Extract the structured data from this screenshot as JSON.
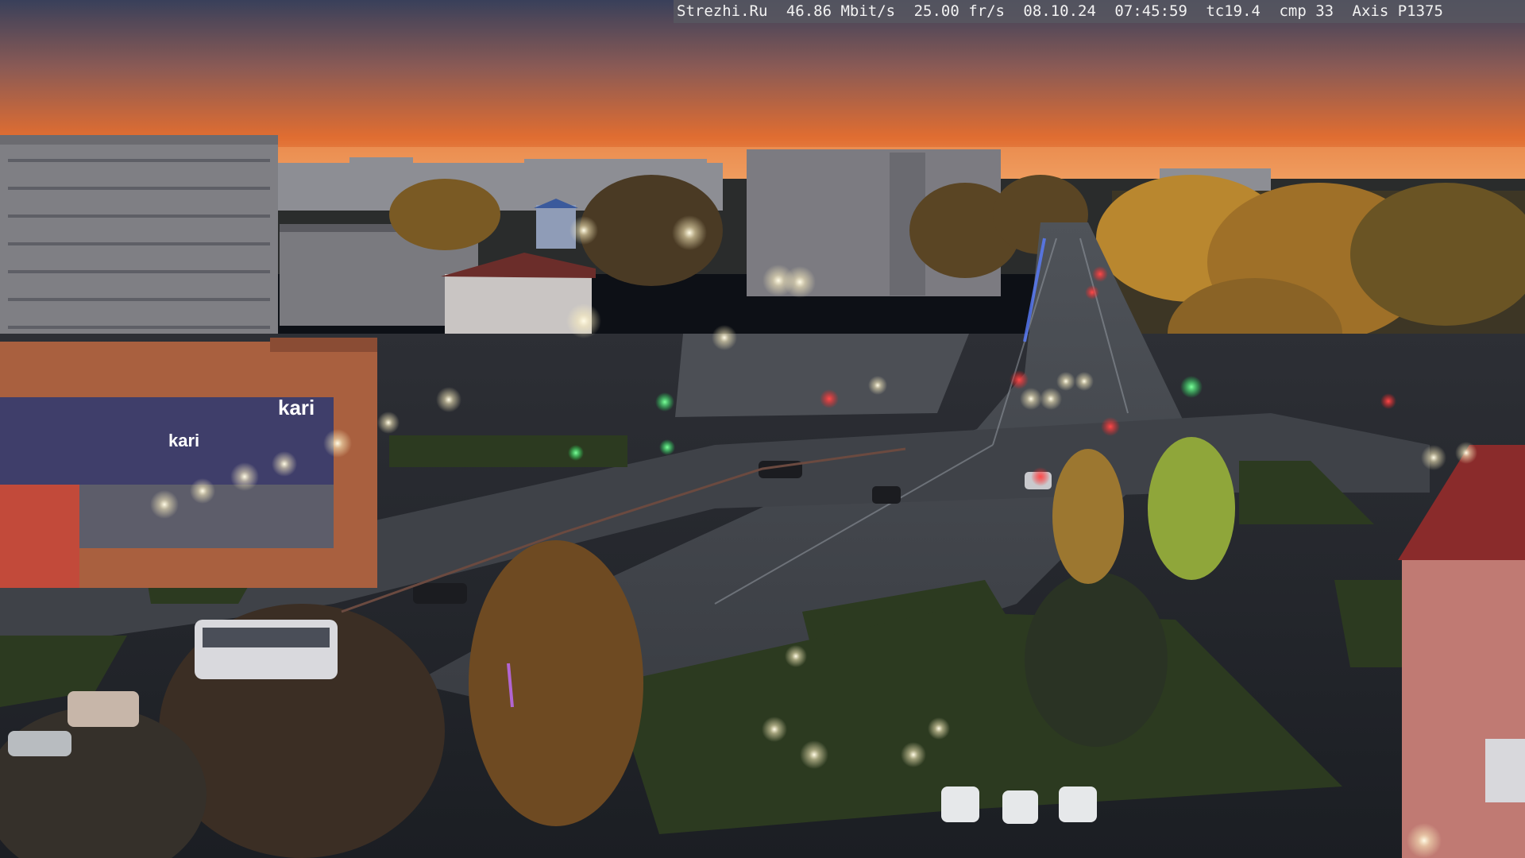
{
  "overlay": {
    "site": "Strezhi.Ru",
    "bitrate": "46.86 Mbit/s",
    "framerate": "25.00 fr/s",
    "date": "08.10.24",
    "time": "07:45:59",
    "tc": "tc19.4",
    "cmp": "cmp 33",
    "camera": "Axis P1375"
  },
  "signs": {
    "store_main": "kari",
    "store_front": "kari"
  },
  "colors": {
    "sky_top": "#33384f",
    "sky_glow": "#e36a2e",
    "horizon": "#f19a5a",
    "asphalt": "#3d4148",
    "grass": "#2d3a22",
    "building": "#7d7c80",
    "store": "#b86a4a",
    "autumn_tree": "#b9872f",
    "street_light": "#fff7d8",
    "traffic_red": "#ff2e2e",
    "traffic_green": "#29ff6a"
  }
}
